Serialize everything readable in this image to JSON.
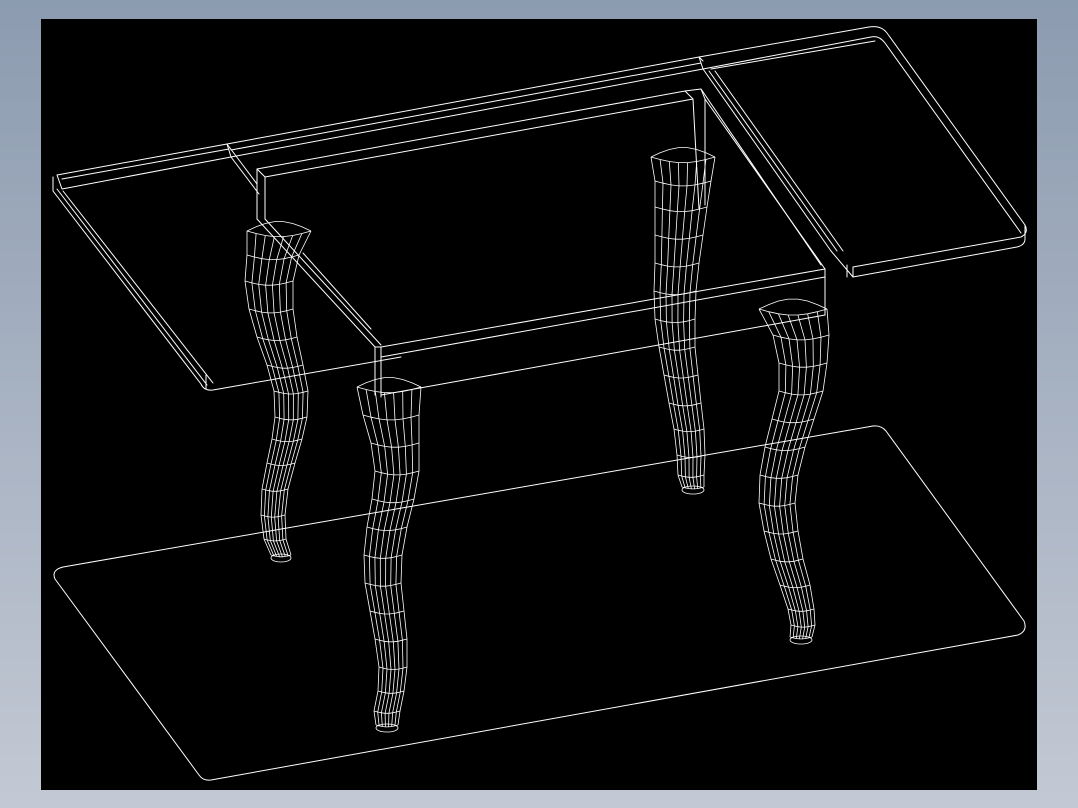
{
  "colors": {
    "background_top": "#8c9bb0",
    "background_bottom": "#c3c9d4",
    "viewport": "#000000",
    "wireframe": "#ffffff"
  },
  "drawing": {
    "subject": "table",
    "parts": [
      "tabletop-left-leaf",
      "tabletop-center",
      "tabletop-right-leaf",
      "apron",
      "leg",
      "leg",
      "leg",
      "leg",
      "floor-plane"
    ]
  }
}
